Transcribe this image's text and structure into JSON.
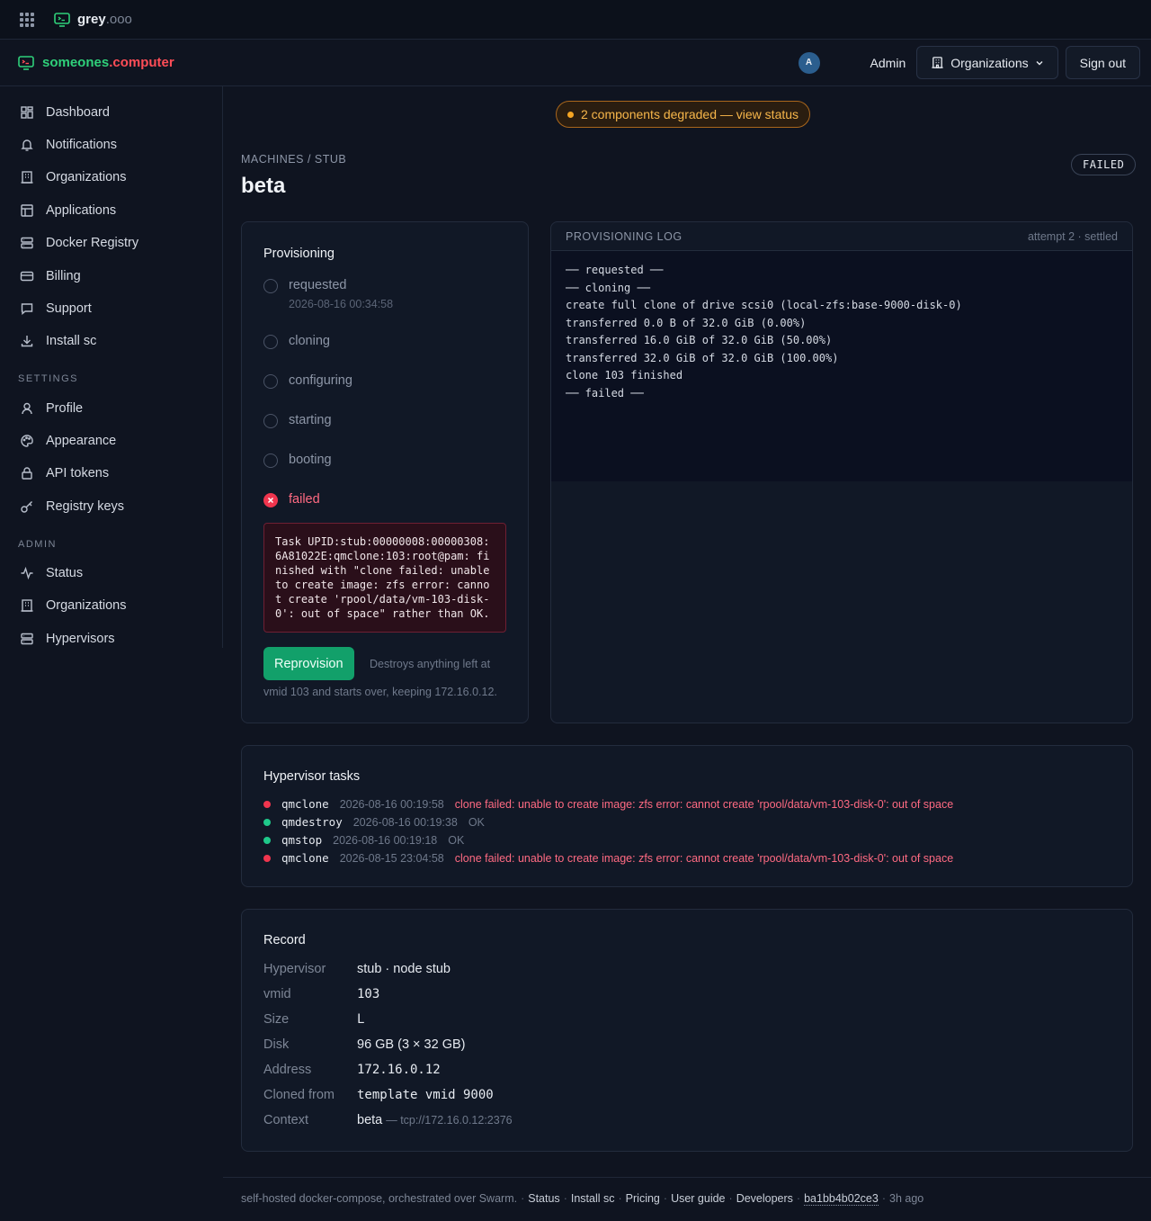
{
  "topbar": {
    "brand_name": "grey",
    "brand_tld": ".ooo"
  },
  "header": {
    "brand_first": "someones",
    "brand_second": ".computer",
    "avatar_initial": "A",
    "user_label": "Admin",
    "orgs_button": "Organizations",
    "signout_button": "Sign out"
  },
  "sidebar": {
    "items": [
      {
        "label": "Dashboard",
        "icon": "dashboard-icon"
      },
      {
        "label": "Notifications",
        "icon": "bell-icon"
      },
      {
        "label": "Organizations",
        "icon": "building-icon"
      },
      {
        "label": "Applications",
        "icon": "layout-icon"
      },
      {
        "label": "Docker Registry",
        "icon": "server-icon"
      },
      {
        "label": "Billing",
        "icon": "card-icon"
      },
      {
        "label": "Support",
        "icon": "chat-icon"
      },
      {
        "label": "Install sc",
        "icon": "download-icon"
      }
    ],
    "settings_heading": "SETTINGS",
    "settings_items": [
      {
        "label": "Profile",
        "icon": "user-icon"
      },
      {
        "label": "Appearance",
        "icon": "palette-icon"
      },
      {
        "label": "API tokens",
        "icon": "lock-icon"
      },
      {
        "label": "Registry keys",
        "icon": "key-icon"
      }
    ],
    "admin_heading": "ADMIN",
    "admin_items": [
      {
        "label": "Status",
        "icon": "activity-icon"
      },
      {
        "label": "Organizations",
        "icon": "building-icon"
      },
      {
        "label": "Hypervisors",
        "icon": "server-icon"
      }
    ]
  },
  "banner": {
    "text": "2 components degraded — view status"
  },
  "breadcrumb": "MACHINES / STUB",
  "title": "beta",
  "status_badge": "FAILED",
  "provisioning": {
    "title": "Provisioning",
    "steps": [
      {
        "label": "requested",
        "sub": "2026-08-16 00:34:58"
      },
      {
        "label": "cloning"
      },
      {
        "label": "configuring"
      },
      {
        "label": "starting"
      },
      {
        "label": "booting"
      },
      {
        "label": "failed"
      }
    ],
    "error": "Task UPID:stub:00000008:00000308:\n6A81022E:qmclone:103:root@pam: fi\nnished with \"clone failed: unable\nto create image: zfs error: canno\nt create 'rpool/data/vm-103-disk-\n0': out of space\" rather than OK.",
    "button": "Reprovision",
    "note_a": "Destroys anything left at",
    "note_b": "vmid 103 and starts over, keeping 172.16.0.12."
  },
  "log": {
    "title": "PROVISIONING LOG",
    "meta": "attempt 2 · settled",
    "lines": [
      "── requested ──",
      "── cloning ──",
      "create full clone of drive scsi0 (local-zfs:base-9000-disk-0)",
      "transferred 0.0 B of 32.0 GiB (0.00%)",
      "transferred 16.0 GiB of 32.0 GiB (50.00%)",
      "transferred 32.0 GiB of 32.0 GiB (100.00%)",
      "clone 103 finished",
      "── failed ──"
    ]
  },
  "tasks": {
    "title": "Hypervisor tasks",
    "rows": [
      {
        "cmd": "qmclone",
        "time": "2026-08-16 00:19:58",
        "msg": "clone failed: unable to create image: zfs error: cannot create 'rpool/data/vm-103-disk-0': out of space",
        "status": "error"
      },
      {
        "cmd": "qmdestroy",
        "time": "2026-08-16 00:19:38",
        "msg": "OK",
        "status": "ok"
      },
      {
        "cmd": "qmstop",
        "time": "2026-08-16 00:19:18",
        "msg": "OK",
        "status": "ok"
      },
      {
        "cmd": "qmclone",
        "time": "2026-08-15 23:04:58",
        "msg": "clone failed: unable to create image: zfs error: cannot create 'rpool/data/vm-103-disk-0': out of space",
        "status": "error"
      }
    ],
    "colors": {
      "error": "#f0354e",
      "ok": "#1fc98a"
    }
  },
  "record": {
    "title": "Record",
    "rows": [
      {
        "key": "Hypervisor",
        "value": "stub · node stub",
        "mono": false
      },
      {
        "key": "vmid",
        "value": "103",
        "mono": true
      },
      {
        "key": "Size",
        "value": "L",
        "mono": true
      },
      {
        "key": "Disk",
        "value": "96 GB (3 × 32 GB)",
        "mono": false
      },
      {
        "key": "Address",
        "value": "172.16.0.12",
        "mono": true
      },
      {
        "key": "Cloned from",
        "value": "template vmid 9000",
        "mono": true
      },
      {
        "key": "Context",
        "value": "beta",
        "mono": false,
        "extra": "— tcp://172.16.0.12:2376"
      }
    ]
  },
  "footer": {
    "text": "self-hosted docker-compose, orchestrated over Swarm.",
    "links": [
      "Status",
      "Install sc",
      "Pricing",
      "User guide",
      "Developers"
    ],
    "hash": "ba1bb4b02ce3",
    "ago": "3h ago"
  }
}
